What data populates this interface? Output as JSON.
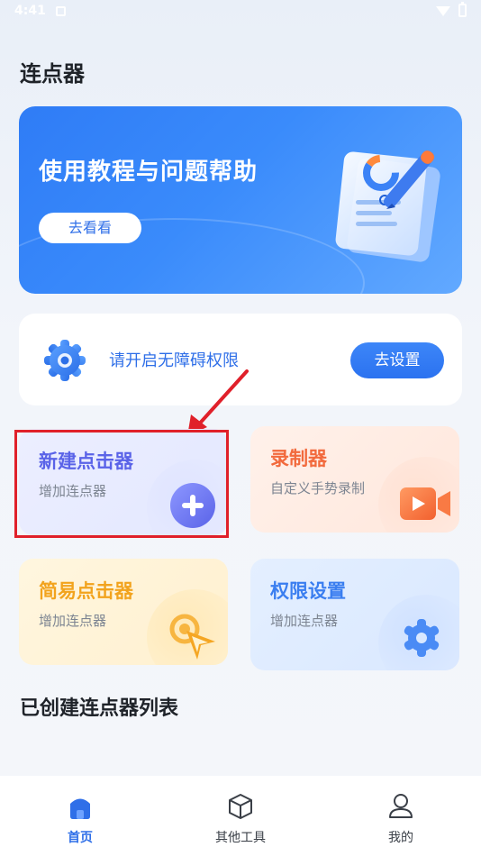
{
  "status_bar": {
    "time": "4:41"
  },
  "header": {
    "title": "连点器"
  },
  "banner": {
    "title": "使用教程与问题帮助",
    "button_label": "去看看"
  },
  "permission": {
    "message": "请开启无障碍权限",
    "button_label": "去设置"
  },
  "tiles": {
    "new_clicker": {
      "title": "新建点击器",
      "subtitle": "增加连点器"
    },
    "recorder": {
      "title": "录制器",
      "subtitle": "自定义手势录制"
    },
    "simple_clicker": {
      "title": "简易点击器",
      "subtitle": "增加连点器"
    },
    "permission_settings": {
      "title": "权限设置",
      "subtitle": "增加连点器"
    }
  },
  "list_section": {
    "title": "已创建连点器列表"
  },
  "tabbar": {
    "tabs": [
      {
        "label": "首页",
        "icon": "home-icon",
        "active": true
      },
      {
        "label": "其他工具",
        "icon": "cube-icon",
        "active": false
      },
      {
        "label": "我的",
        "icon": "user-icon",
        "active": false
      }
    ]
  },
  "colors": {
    "accent": "#2f6fe8",
    "highlight": "#e0202a"
  }
}
